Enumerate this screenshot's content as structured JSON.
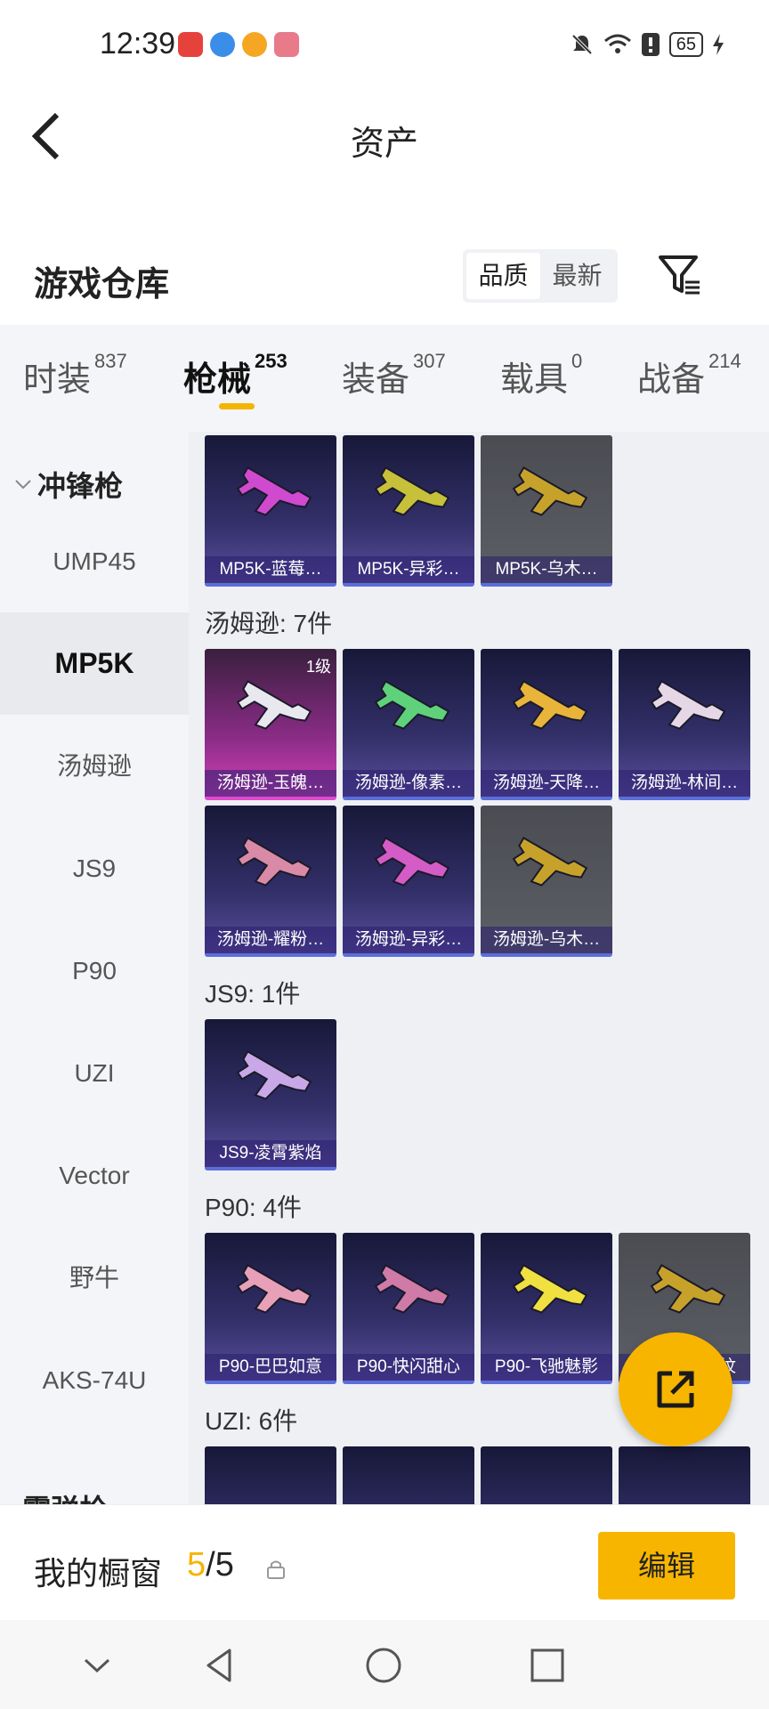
{
  "status_bar": {
    "time": "12:39",
    "battery": "65"
  },
  "header": {
    "title": "资产"
  },
  "warehouse": {
    "title": "游戏仓库",
    "sort_options": [
      {
        "label": "品质",
        "active": true
      },
      {
        "label": "最新",
        "active": false
      }
    ]
  },
  "tabs": [
    {
      "label": "时装",
      "count": "837"
    },
    {
      "label": "枪械",
      "count": "253",
      "active": true
    },
    {
      "label": "装备",
      "count": "307"
    },
    {
      "label": "载具",
      "count": "0"
    },
    {
      "label": "战备",
      "count": "214"
    }
  ],
  "sidebar": {
    "category": "冲锋枪",
    "items": [
      "UMP45",
      "MP5K",
      "汤姆逊",
      "JS9",
      "P90",
      "UZI",
      "Vector",
      "野牛",
      "AKS-74U"
    ],
    "active_item": "MP5K",
    "next_category": "霰弹枪"
  },
  "groups": [
    {
      "label": "",
      "items": [
        {
          "name": "MP5K-蓝莓…",
          "style": "purple",
          "gun_color": "#d04ad0"
        },
        {
          "name": "MP5K-异彩…",
          "style": "purple",
          "gun_color": "#c7c03a"
        },
        {
          "name": "MP5K-乌木…",
          "style": "grey",
          "gun_color": "#c7a22a"
        }
      ]
    },
    {
      "label": "汤姆逊: 7件",
      "items": [
        {
          "name": "汤姆逊-玉魄…",
          "style": "pink",
          "gun_color": "#e8e8ee",
          "level": "1级"
        },
        {
          "name": "汤姆逊-像素…",
          "style": "purple",
          "gun_color": "#5fd17a"
        },
        {
          "name": "汤姆逊-天降…",
          "style": "purple",
          "gun_color": "#e8b43a"
        },
        {
          "name": "汤姆逊-林间…",
          "style": "purple",
          "gun_color": "#e6d7e6"
        },
        {
          "name": "汤姆逊-耀粉…",
          "style": "purple",
          "gun_color": "#d98aa6"
        },
        {
          "name": "汤姆逊-异彩…",
          "style": "purple",
          "gun_color": "#d45cc7"
        },
        {
          "name": "汤姆逊-乌木…",
          "style": "grey",
          "gun_color": "#c7a22a"
        }
      ]
    },
    {
      "label": "JS9: 1件",
      "items": [
        {
          "name": "JS9-凌霄紫焰",
          "style": "purple",
          "gun_color": "#c9a8e8"
        }
      ]
    },
    {
      "label": "P90: 4件",
      "items": [
        {
          "name": "P90-巴巴如意",
          "style": "purple",
          "gun_color": "#e8a0b8"
        },
        {
          "name": "P90-快闪甜心",
          "style": "purple",
          "gun_color": "#d07aa8"
        },
        {
          "name": "P90-飞驰魅影",
          "style": "purple",
          "gun_color": "#f0e040"
        },
        {
          "name": "P90-乌木…纹",
          "style": "grey",
          "gun_color": "#c7a22a"
        }
      ]
    },
    {
      "label": "UZI: 6件",
      "items": []
    }
  ],
  "bottom": {
    "label": "我的橱窗",
    "current": "5",
    "total": "/5",
    "edit_label": "编辑"
  }
}
